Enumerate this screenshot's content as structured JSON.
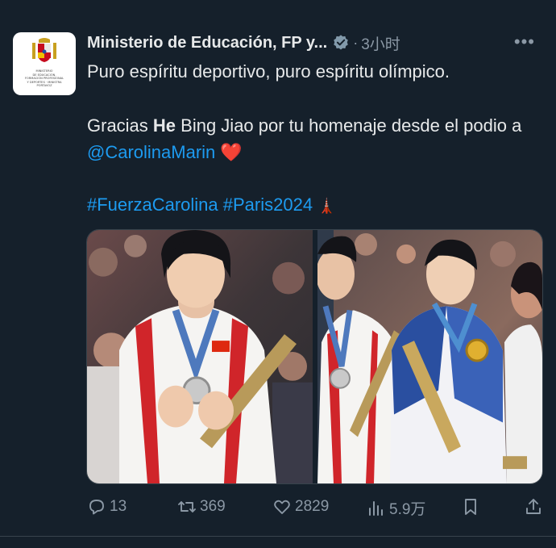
{
  "account": {
    "name": "Ministerio de Educación, FP y...",
    "time": "3小时",
    "avatar_lines": [
      "MINISTERIO",
      "DE EDUCACIÓN,",
      "FORMACIÓN PROFESIONAL",
      "Y DEPORTES · MINISTRA",
      "PORTAVOZ"
    ]
  },
  "tweet": {
    "line1": "Puro espíritu deportivo, puro espíritu olímpico.",
    "thanks_pre": "Gracias ",
    "thanks_bold": "He",
    "thanks_post": " Bing Jiao por tu homenaje desde el podio a ",
    "mention": "@CarolinaMarin",
    "heart": "❤️",
    "hashtag1": "#FuerzaCarolina",
    "hashtag2": "#Paris2024",
    "tower": "🗼"
  },
  "stats": {
    "replies": "13",
    "retweets": "369",
    "likes": "2829",
    "views": "5.9万"
  },
  "colors": {
    "background": "#15202b",
    "text": "#e7e9ea",
    "muted": "#8b98a5",
    "link": "#1d9bf0",
    "verified": "#829aab"
  }
}
